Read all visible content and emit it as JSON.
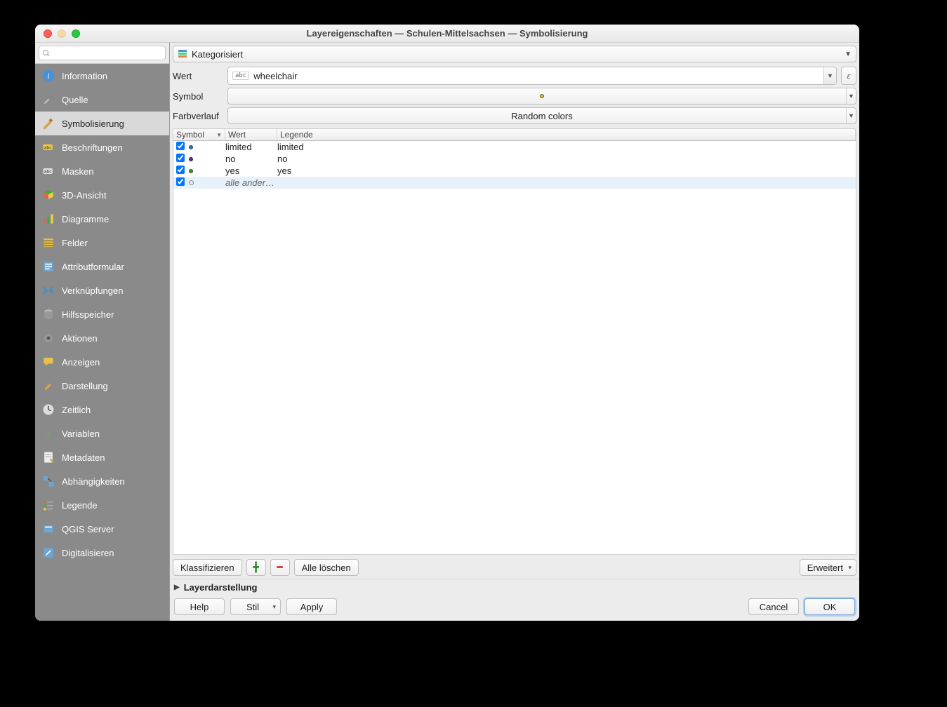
{
  "titlebar": "Layereigenschaften — Schulen-Mittelsachsen — Symbolisierung",
  "sidebar": {
    "search_placeholder": "",
    "items": [
      {
        "label": "Information"
      },
      {
        "label": "Quelle"
      },
      {
        "label": "Symbolisierung"
      },
      {
        "label": "Beschriftungen"
      },
      {
        "label": "Masken"
      },
      {
        "label": "3D-Ansicht"
      },
      {
        "label": "Diagramme"
      },
      {
        "label": "Felder"
      },
      {
        "label": "Attributformular"
      },
      {
        "label": "Verknüpfungen"
      },
      {
        "label": "Hilfsspeicher"
      },
      {
        "label": "Aktionen"
      },
      {
        "label": "Anzeigen"
      },
      {
        "label": "Darstellung"
      },
      {
        "label": "Zeitlich"
      },
      {
        "label": "Variablen"
      },
      {
        "label": "Metadaten"
      },
      {
        "label": "Abhängigkeiten"
      },
      {
        "label": "Legende"
      },
      {
        "label": "QGIS Server"
      },
      {
        "label": "Digitalisieren"
      }
    ]
  },
  "renderer": {
    "selected": "Kategorisiert"
  },
  "fields": {
    "wert_label": "Wert",
    "wert_value": "wheelchair",
    "symbol_label": "Symbol",
    "ramp_label": "Farbverlauf",
    "ramp_value": "Random colors"
  },
  "table": {
    "cols": {
      "symbol": "Symbol",
      "wert": "Wert",
      "legende": "Legende"
    },
    "rows": [
      {
        "checked": true,
        "color": "#2a7aa8",
        "wert": "limited",
        "legende": "limited"
      },
      {
        "checked": true,
        "color": "#6b2a78",
        "wert": "no",
        "legende": "no"
      },
      {
        "checked": true,
        "color": "#3a9a2a",
        "wert": "yes",
        "legende": "yes"
      },
      {
        "checked": true,
        "ring": true,
        "wert": "alle ander…",
        "legende": "",
        "italic": true,
        "selected": true
      }
    ]
  },
  "buttons": {
    "classify": "Klassifizieren",
    "delete_all": "Alle löschen",
    "advanced": "Erweitert"
  },
  "layerrender": "Layerdarstellung",
  "footer": {
    "help": "Help",
    "style": "Stil",
    "apply": "Apply",
    "cancel": "Cancel",
    "ok": "OK"
  },
  "symbol_preview_color": "#c9b23a"
}
